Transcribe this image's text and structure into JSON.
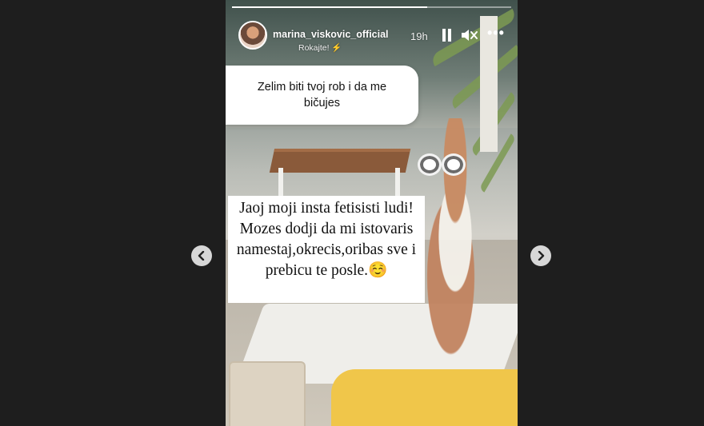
{
  "story": {
    "header": {
      "username": "marina_viskovic_official",
      "subtitle": "Rokajte! ⚡",
      "timestamp": "19h",
      "more_label": "•••"
    },
    "progress": 0.7,
    "question_sticker": "Zelim biti tvoj rob i da me bičujes",
    "answer_text": "Jaoj moji insta fetisisti ludi! Mozes dodji da mi istovaris namestaj,okrecis,oribas sve i prebicu te posle.☺️"
  },
  "navigation": {
    "prev_icon": "chevron-left-icon",
    "next_icon": "chevron-right-icon"
  },
  "colors": {
    "background": "#1e1e1e",
    "nav_button": "#d7d7d7",
    "towel": "#f0c64a"
  }
}
